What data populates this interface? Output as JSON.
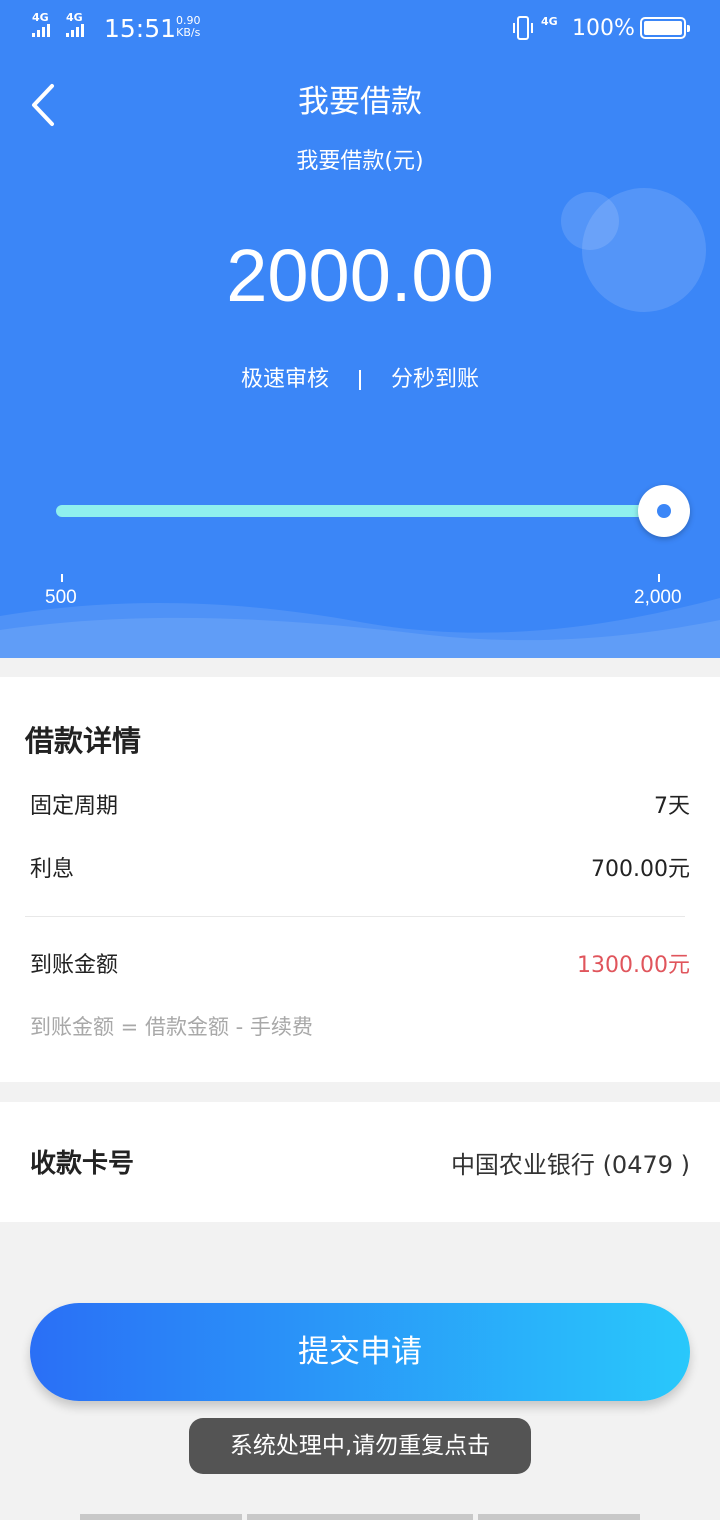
{
  "status_bar": {
    "signal1": "4G",
    "signal2": "4G",
    "time": "15:51",
    "speed_value": "0.90",
    "speed_unit": "KB/s",
    "net": "4G",
    "battery": "100%"
  },
  "header": {
    "title": "我要借款",
    "amount_label": "我要借款(元)",
    "amount": "2000.00",
    "feature_1": "极速审核",
    "feature_2": "分秒到账",
    "background_color": "#3b86f7"
  },
  "slider": {
    "min_label": "500",
    "max_label": "2,000",
    "min": 500,
    "max": 2000,
    "value": 2000
  },
  "details": {
    "title": "借款详情",
    "period_label": "固定周期",
    "period_value": "7天",
    "interest_label": "利息",
    "interest_value": "700.00元",
    "received_label": "到账金额",
    "received_value": "1300.00元",
    "formula": "到账金额 = 借款金额 - 手续费",
    "highlight_color": "#e0555c"
  },
  "bank_card": {
    "label": "收款卡号",
    "value": "中国农业银行 (0479 )"
  },
  "submit": {
    "label": "提交申请"
  },
  "toast": {
    "message": "系统处理中,请勿重复点击"
  }
}
